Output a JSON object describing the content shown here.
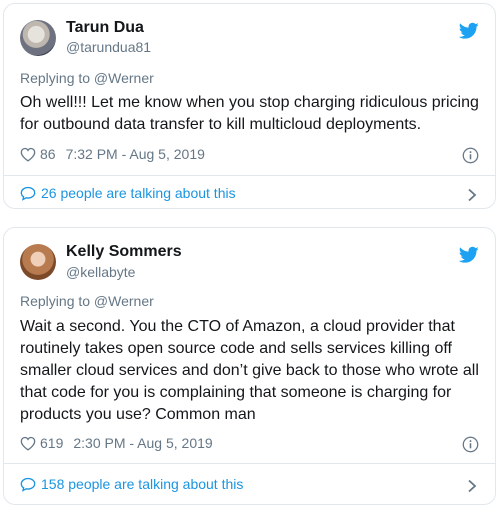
{
  "colors": {
    "text": "#14171a",
    "secondary": "#657786",
    "accent": "#1b95e0",
    "twitter_blue": "#1da1f2",
    "border": "#e1e8ed"
  },
  "tweets": [
    {
      "name": "Tarun Dua",
      "handle": "@tarundua81",
      "replying_to": "Replying to @Werner",
      "text": "Oh well!!! Let me know when you stop charging ridiculous pricing for outbound data transfer to kill multicloud deployments.",
      "likes": "86",
      "timestamp": "7:32 PM - Aug 5, 2019",
      "talking": "26 people are talking about this",
      "icons": [
        "twitter-bird-icon",
        "heart-icon",
        "info-icon",
        "comment-bubble-icon",
        "chevron-right-icon"
      ]
    },
    {
      "name": "Kelly Sommers",
      "handle": "@kellabyte",
      "replying_to": "Replying to @Werner",
      "text": "Wait a second. You the CTO of Amazon, a cloud provider that routinely takes open source code and sells services killing off smaller cloud services and don’t give back to those who wrote all that code for you is complaining that someone is charging for products you use? Common man",
      "likes": "619",
      "timestamp": "2:30 PM - Aug 5, 2019",
      "talking": "158 people are talking about this",
      "icons": [
        "twitter-bird-icon",
        "heart-icon",
        "info-icon",
        "comment-bubble-icon",
        "chevron-right-icon"
      ]
    }
  ]
}
